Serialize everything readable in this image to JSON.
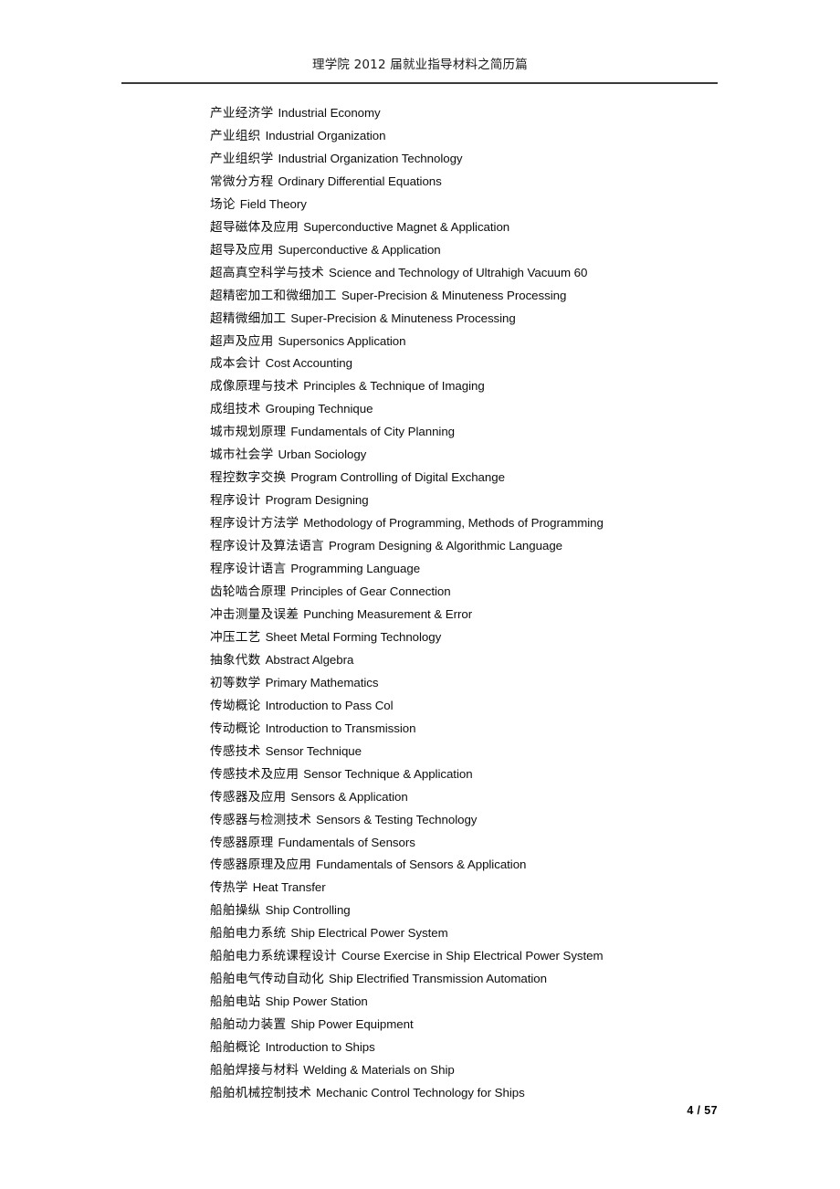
{
  "header": {
    "title": "理学院 2012 届就业指导材料之简历篇",
    "rule_color": "#3a3a3a"
  },
  "footer": {
    "page_label": "4 / 57",
    "current_page": 4,
    "total_pages": 57
  },
  "document": {
    "text_color": "#0d0d0d",
    "background_color": "#ffffff"
  },
  "entries": [
    {
      "cn": "产业经济学",
      "en": "Industrial Economy"
    },
    {
      "cn": "产业组织",
      "en": "Industrial Organization"
    },
    {
      "cn": "产业组织学",
      "en": "Industrial Organization Technology"
    },
    {
      "cn": "常微分方程",
      "en": "Ordinary Differential Equations"
    },
    {
      "cn": "场论",
      "en": "Field Theory"
    },
    {
      "cn": "超导磁体及应用",
      "en": "Superconductive Magnet & Application"
    },
    {
      "cn": "超导及应用",
      "en": "Superconductive & Application"
    },
    {
      "cn": "超高真空科学与技术",
      "en": "Science and Technology of Ultrahigh Vacuum 60"
    },
    {
      "cn": "超精密加工和微细加工",
      "en": "Super-Precision & Minuteness Processing"
    },
    {
      "cn": "超精微细加工",
      "en": "Super-Precision & Minuteness Processing"
    },
    {
      "cn": "超声及应用",
      "en": "Supersonics Application"
    },
    {
      "cn": "成本会计",
      "en": "Cost Accounting"
    },
    {
      "cn": "成像原理与技术",
      "en": "Principles & Technique of Imaging"
    },
    {
      "cn": "成组技术",
      "en": "Grouping Technique"
    },
    {
      "cn": "城市规划原理",
      "en": "Fundamentals of City Planning"
    },
    {
      "cn": "城市社会学",
      "en": "Urban Sociology"
    },
    {
      "cn": "程控数字交换",
      "en": "Program Controlling of Digital Exchange"
    },
    {
      "cn": "程序设计",
      "en": "Program Designing"
    },
    {
      "cn": "程序设计方法学",
      "en": "Methodology of Programming, Methods of Programming"
    },
    {
      "cn": "程序设计及算法语言",
      "en": "Program Designing & Algorithmic Language"
    },
    {
      "cn": "程序设计语言",
      "en": "Programming Language"
    },
    {
      "cn": "齿轮啮合原理",
      "en": "Principles of Gear Connection"
    },
    {
      "cn": "冲击测量及误差",
      "en": "Punching Measurement & Error"
    },
    {
      "cn": "冲压工艺",
      "en": "Sheet Metal Forming Technology"
    },
    {
      "cn": "抽象代数",
      "en": "Abstract Algebra"
    },
    {
      "cn": "初等数学",
      "en": "Primary Mathematics"
    },
    {
      "cn": "传坳概论",
      "en": "Introduction to Pass Col"
    },
    {
      "cn": "传动概论",
      "en": "Introduction to Transmission"
    },
    {
      "cn": "传感技术",
      "en": "Sensor Technique"
    },
    {
      "cn": "传感技术及应用",
      "en": "Sensor Technique & Application"
    },
    {
      "cn": "传感器及应用",
      "en": "Sensors & Application"
    },
    {
      "cn": "传感器与检测技术",
      "en": "Sensors & Testing Technology"
    },
    {
      "cn": "传感器原理",
      "en": "Fundamentals of Sensors"
    },
    {
      "cn": "传感器原理及应用",
      "en": "Fundamentals of Sensors & Application"
    },
    {
      "cn": "传热学",
      "en": "Heat Transfer"
    },
    {
      "cn": "船舶操纵",
      "en": "Ship Controlling"
    },
    {
      "cn": "船舶电力系统",
      "en": "Ship Electrical Power System"
    },
    {
      "cn": "船舶电力系统课程设计",
      "en": "Course Exercise in Ship Electrical Power System"
    },
    {
      "cn": "船舶电气传动自动化",
      "en": "Ship Electrified Transmission Automation"
    },
    {
      "cn": "船舶电站",
      "en": "Ship Power Station"
    },
    {
      "cn": "船舶动力装置",
      "en": "Ship Power Equipment"
    },
    {
      "cn": "船舶概论",
      "en": "Introduction to Ships"
    },
    {
      "cn": "船舶焊接与材料",
      "en": "Welding & Materials on Ship"
    },
    {
      "cn": "船舶机械控制技术",
      "en": "Mechanic Control Technology for Ships"
    }
  ]
}
